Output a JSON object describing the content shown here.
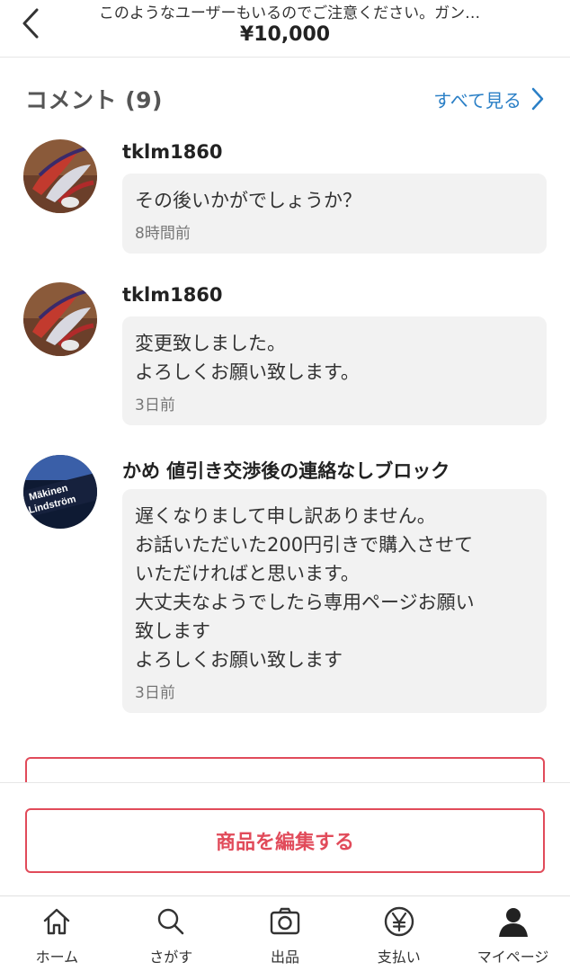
{
  "header": {
    "title": "このようなユーザーもいるのでご注意ください。ガン…",
    "price": "¥10,000"
  },
  "comments_section": {
    "title": "コメント (9)",
    "see_all": "すべて見る"
  },
  "comments": [
    {
      "user": "tklm1860",
      "text": "その後いかがでしょうか？",
      "time": "8時間前"
    },
    {
      "user": "tklm1860",
      "text": "変更致しました。\nよろしくお願い致します。",
      "time": "3日前"
    },
    {
      "user": "かめ 値引き交渉後の連絡なしブロック",
      "avatar_text_line1": "Mäkinen",
      "avatar_text_line2": "Lindström",
      "text": "遅くなりまして申し訳ありません。\nお話いただいた200円引きで購入させて\nいただければと思います。\n大丈夫なようでしたら専用ページお願い\n致します\nよろしくお願い致します",
      "time": "3日前"
    }
  ],
  "edit_button": "商品を編集する",
  "tabbar": [
    {
      "label": "ホーム",
      "icon": "home-icon"
    },
    {
      "label": "さがす",
      "icon": "search-icon"
    },
    {
      "label": "出品",
      "icon": "camera-icon"
    },
    {
      "label": "支払い",
      "icon": "yen-icon"
    },
    {
      "label": "マイページ",
      "icon": "person-icon"
    }
  ],
  "colors": {
    "accent": "#e14b5a",
    "link": "#2a7fc6"
  }
}
